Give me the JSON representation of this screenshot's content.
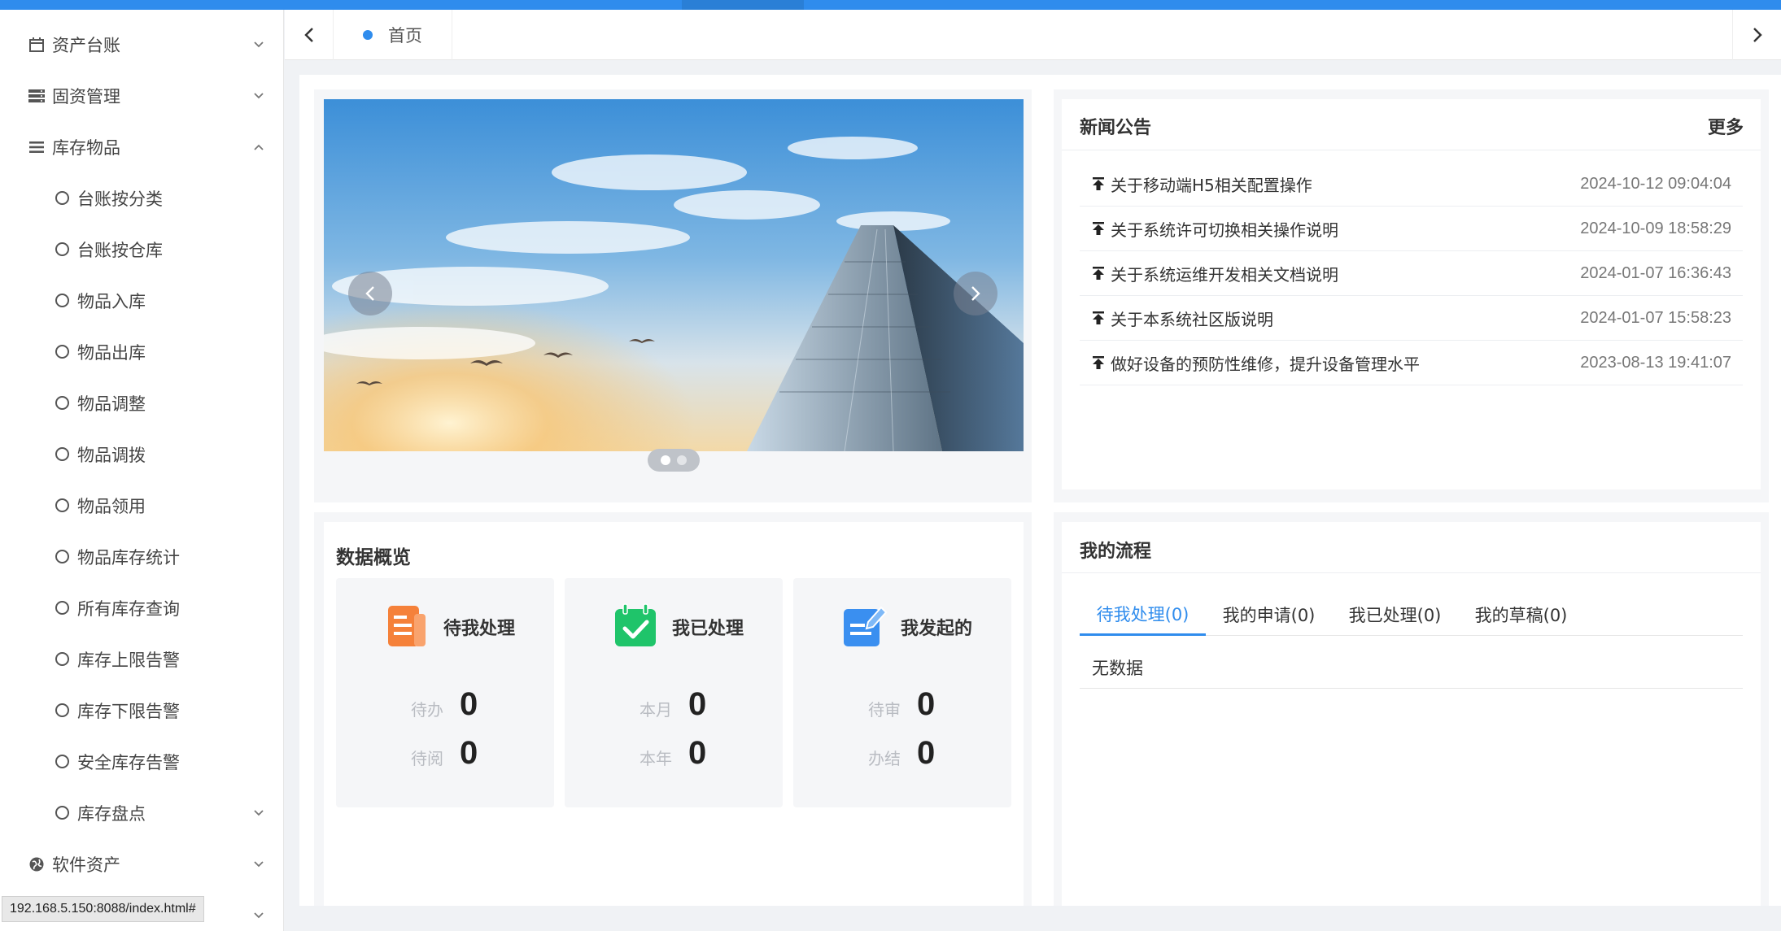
{
  "sidebar": {
    "items": [
      {
        "label": "资产台账",
        "icon": "calendar-icon",
        "expanded": false
      },
      {
        "label": "固资管理",
        "icon": "server-icon",
        "expanded": false
      },
      {
        "label": "库存物品",
        "icon": "list-icon",
        "expanded": true
      },
      {
        "label": "软件资产",
        "icon": "globe-icon",
        "expanded": false
      }
    ],
    "sub_items": [
      {
        "label": "台账按分类"
      },
      {
        "label": "台账按仓库"
      },
      {
        "label": "物品入库"
      },
      {
        "label": "物品出库"
      },
      {
        "label": "物品调整"
      },
      {
        "label": "物品调拨"
      },
      {
        "label": "物品领用"
      },
      {
        "label": "物品库存统计"
      },
      {
        "label": "所有库存查询"
      },
      {
        "label": "库存上限告警"
      },
      {
        "label": "库存下限告警"
      },
      {
        "label": "安全库存告警"
      },
      {
        "label": "库存盘点"
      }
    ]
  },
  "status_bar": {
    "url": "192.168.5.150:8088/index.html#"
  },
  "tabs": {
    "home_label": "首页"
  },
  "carousel": {
    "slide_count": 2,
    "active_index": 0
  },
  "news": {
    "title": "新闻公告",
    "more_label": "更多",
    "items": [
      {
        "text": "关于移动端H5相关配置操作",
        "time": "2024-10-12 09:04:04"
      },
      {
        "text": "关于系统许可切换相关操作说明",
        "time": "2024-10-09 18:58:29"
      },
      {
        "text": "关于系统运维开发相关文档说明",
        "time": "2024-01-07 16:36:43"
      },
      {
        "text": "关于本系统社区版说明",
        "time": "2024-01-07 15:58:23"
      },
      {
        "text": "做好设备的预防性维修，提升设备管理水平",
        "time": "2023-08-13 19:41:07"
      }
    ]
  },
  "overview": {
    "title": "数据概览",
    "boxes": [
      {
        "title": "待我处理",
        "icon": "document-icon",
        "rows": [
          {
            "label": "待办",
            "value": "0"
          },
          {
            "label": "待阅",
            "value": "0"
          }
        ]
      },
      {
        "title": "我已处理",
        "icon": "calendar-check-icon",
        "rows": [
          {
            "label": "本月",
            "value": "0"
          },
          {
            "label": "本年",
            "value": "0"
          }
        ]
      },
      {
        "title": "我发起的",
        "icon": "edit-icon",
        "rows": [
          {
            "label": "待审",
            "value": "0"
          },
          {
            "label": "办结",
            "value": "0"
          }
        ]
      }
    ]
  },
  "workflow": {
    "title": "我的流程",
    "tabs": [
      {
        "label": "待我处理(0)",
        "active": true
      },
      {
        "label": "我的申请(0)",
        "active": false
      },
      {
        "label": "我已处理(0)",
        "active": false
      },
      {
        "label": "我的草稿(0)",
        "active": false
      }
    ],
    "empty_text": "无数据"
  },
  "colors": {
    "accent": "#2f8ced",
    "orange": "#f5813a",
    "green": "#1fc46a",
    "blue": "#3a8ff0"
  }
}
